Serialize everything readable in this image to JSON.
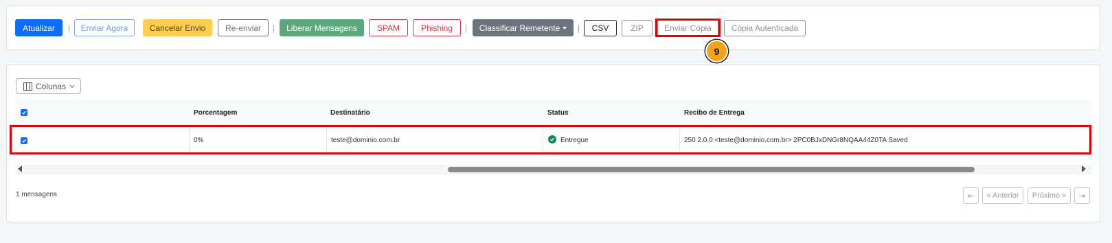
{
  "toolbar": {
    "atualizar": "Atualizar",
    "enviar_agora": "Enviar Agora",
    "cancelar_envio": "Cancelar Envio",
    "re_enviar": "Re-enviar",
    "liberar_mensagens": "Liberar Mensagens",
    "spam": "SPAM",
    "phishing": "Phishing",
    "classificar_remetente": "Classificar Remetente",
    "csv": "CSV",
    "zip": "ZIP",
    "enviar_copia": "Enviar Cópia",
    "copia_autenticada": "Cópia Autenticada",
    "separator": "|"
  },
  "step_badge": "9",
  "columns_button": "Colunas",
  "table": {
    "headers": [
      "Porcentagem",
      "Destinatário",
      "Status",
      "Recibo de Entrega"
    ],
    "rows": [
      {
        "porcentagem": "0%",
        "destinatario": "teste@dominio.com.br",
        "status": "Entregue",
        "recibo": "250 2.0.0 <teste@dominio.com.br> 2PC0BJxDNGr8NQAA44Z0TA Saved",
        "checked": true
      }
    ]
  },
  "footer": {
    "count": "1 mensagens",
    "first": "⇤",
    "prev": "« Anterior",
    "next": "Próximo »",
    "last": "⇥"
  },
  "colors": {
    "primary": "#0d6efd",
    "danger": "#dc3545",
    "success": "#198754",
    "highlight": "#e10000",
    "badge": "#f7a21b"
  }
}
